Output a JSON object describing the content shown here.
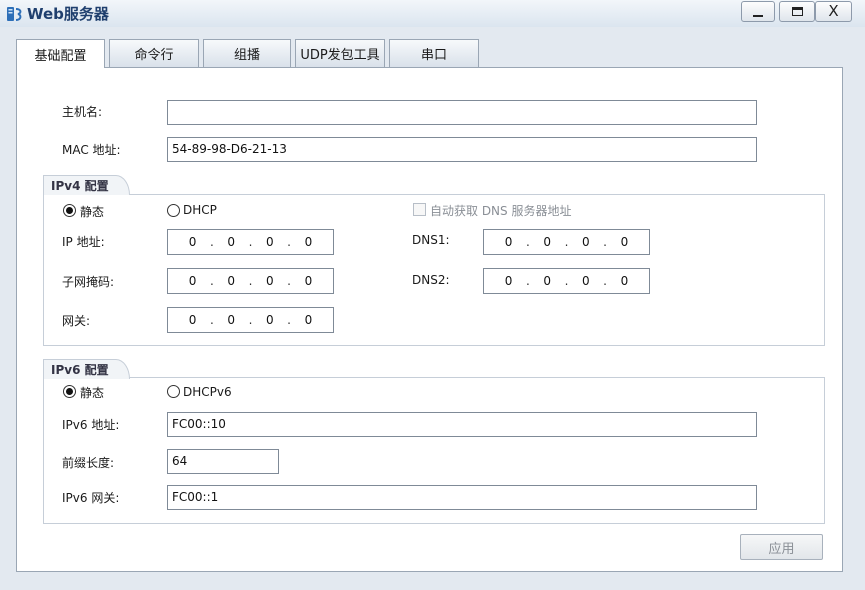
{
  "window": {
    "title": "Web服务器",
    "close_glyph": "X"
  },
  "tabs": [
    {
      "label": "基础配置",
      "active": true
    },
    {
      "label": "命令行",
      "active": false
    },
    {
      "label": "组播",
      "active": false
    },
    {
      "label": "UDP发包工具",
      "active": false
    },
    {
      "label": "串口",
      "active": false
    }
  ],
  "basic": {
    "hostname_label": "主机名:",
    "hostname_value": "",
    "mac_label": "MAC 地址:",
    "mac_value": "54-89-98-D6-21-13"
  },
  "ipv4": {
    "group_title": "IPv4 配置",
    "static_label": "静态",
    "static_checked": true,
    "dhcp_label": "DHCP",
    "dhcp_checked": false,
    "auto_dns_label": "自动获取 DNS 服务器地址",
    "auto_dns_checked": false,
    "ip_label": "IP 地址:",
    "ip_octets": [
      "0",
      "0",
      "0",
      "0"
    ],
    "mask_label": "子网掩码:",
    "mask_octets": [
      "0",
      "0",
      "0",
      "0"
    ],
    "gateway_label": "网关:",
    "gateway_octets": [
      "0",
      "0",
      "0",
      "0"
    ],
    "dns1_label": "DNS1:",
    "dns1_octets": [
      "0",
      "0",
      "0",
      "0"
    ],
    "dns2_label": "DNS2:",
    "dns2_octets": [
      "0",
      "0",
      "0",
      "0"
    ],
    "separator": "."
  },
  "ipv6": {
    "group_title": "IPv6 配置",
    "static_label": "静态",
    "static_checked": true,
    "dhcpv6_label": "DHCPv6",
    "dhcpv6_checked": false,
    "address_label": "IPv6 地址:",
    "address_value": "FC00::10",
    "prefix_label": "前缀长度:",
    "prefix_value": "64",
    "gateway_label": "IPv6 网关:",
    "gateway_value": "FC00::1"
  },
  "apply_label": "应用",
  "colors": {
    "background": "#e3e9f0",
    "title_text": "#1f3f6e",
    "disabled_text": "#8a8f96"
  }
}
